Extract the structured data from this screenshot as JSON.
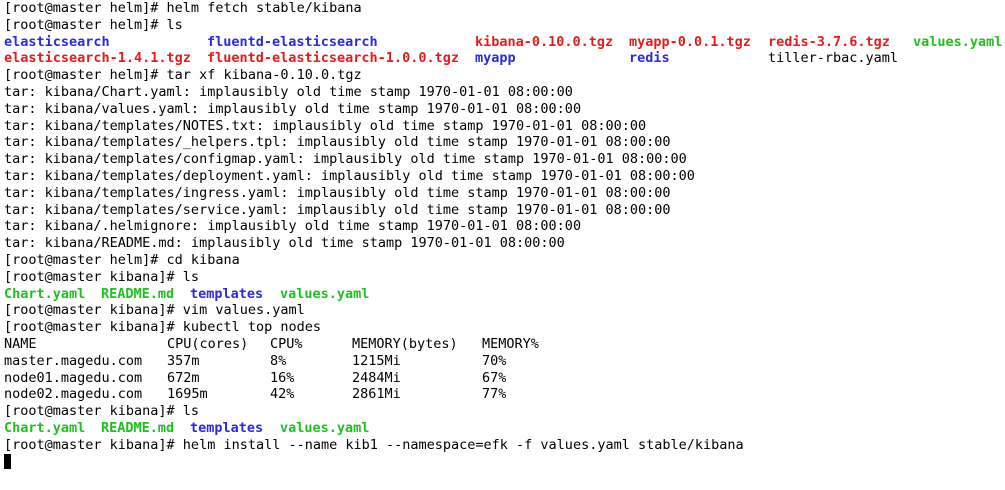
{
  "lines": {
    "l1": "[root@master helm]# helm fetch stable/kibana",
    "l2": "[root@master helm]# ls",
    "l5": "[root@master helm]# tar xf kibana-0.10.0.tgz",
    "l6": "tar: kibana/Chart.yaml: implausibly old time stamp 1970-01-01 08:00:00",
    "l7": "tar: kibana/values.yaml: implausibly old time stamp 1970-01-01 08:00:00",
    "l8": "tar: kibana/templates/NOTES.txt: implausibly old time stamp 1970-01-01 08:00:00",
    "l9": "tar: kibana/templates/_helpers.tpl: implausibly old time stamp 1970-01-01 08:00:00",
    "l10": "tar: kibana/templates/configmap.yaml: implausibly old time stamp 1970-01-01 08:00:00",
    "l11": "tar: kibana/templates/deployment.yaml: implausibly old time stamp 1970-01-01 08:00:00",
    "l12": "tar: kibana/templates/ingress.yaml: implausibly old time stamp 1970-01-01 08:00:00",
    "l13": "tar: kibana/templates/service.yaml: implausibly old time stamp 1970-01-01 08:00:00",
    "l14": "tar: kibana/.helmignore: implausibly old time stamp 1970-01-01 08:00:00",
    "l15": "tar: kibana/README.md: implausibly old time stamp 1970-01-01 08:00:00",
    "l16": "[root@master helm]# cd kibana",
    "l17": "[root@master kibana]# ls",
    "l19": "[root@master kibana]# vim values.yaml",
    "l20": "[root@master kibana]# kubectl top nodes",
    "l25": "[root@master kibana]# ls",
    "l27": "[root@master kibana]# helm install --name kib1 --namespace=efk -f values.yaml stable/kibana"
  },
  "ls_helm": {
    "row1": [
      "elasticsearch",
      "fluentd-elasticsearch",
      "kibana-0.10.0.tgz",
      "myapp-0.0.1.tgz",
      "redis-3.7.6.tgz",
      "values.yaml"
    ],
    "row2": [
      "elasticsearch-1.4.1.tgz",
      "fluentd-elasticsearch-1.0.0.tgz",
      "myapp",
      "redis",
      "tiller-rbac.yaml"
    ]
  },
  "ls_kibana": {
    "first": [
      "Chart.yaml",
      "README.md",
      "templates",
      "values.yaml"
    ],
    "second": [
      "Chart.yaml",
      "README.md",
      "templates",
      "values.yaml"
    ]
  },
  "top_nodes": {
    "headers": [
      "NAME",
      "CPU(cores)",
      "CPU%",
      "MEMORY(bytes)",
      "MEMORY%"
    ],
    "rows": [
      [
        "master.magedu.com",
        "357m",
        "8%",
        "1215Mi",
        "70%"
      ],
      [
        "node01.magedu.com",
        "672m",
        "16%",
        "2484Mi",
        "67%"
      ],
      [
        "node02.magedu.com",
        "1695m",
        "42%",
        "2861Mi",
        "77%"
      ]
    ]
  },
  "colors": {
    "background": "#ffffff",
    "text": "#000000",
    "directory": "#2a2ae0",
    "archive": "#e51c1c",
    "regular_file": "#20c020"
  }
}
